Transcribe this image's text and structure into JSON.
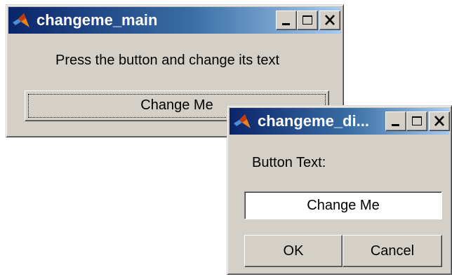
{
  "colors": {
    "window_face": "#d4d0c8",
    "titlebar_start": "#0a246a",
    "titlebar_end": "#a6caf0",
    "title_text": "#ffffff",
    "field_background": "#ffffff"
  },
  "icons": {
    "app": "matlab-logo-icon",
    "minimize": "minimize-icon",
    "maximize": "maximize-icon",
    "close": "close-icon"
  },
  "main_window": {
    "title": "changeme_main",
    "instruction": "Press the button and change its text",
    "button_label": "Change Me"
  },
  "dialog_window": {
    "title": "changeme_di...",
    "field_label": "Button Text:",
    "field_value": "Change Me",
    "ok_label": "OK",
    "cancel_label": "Cancel"
  }
}
